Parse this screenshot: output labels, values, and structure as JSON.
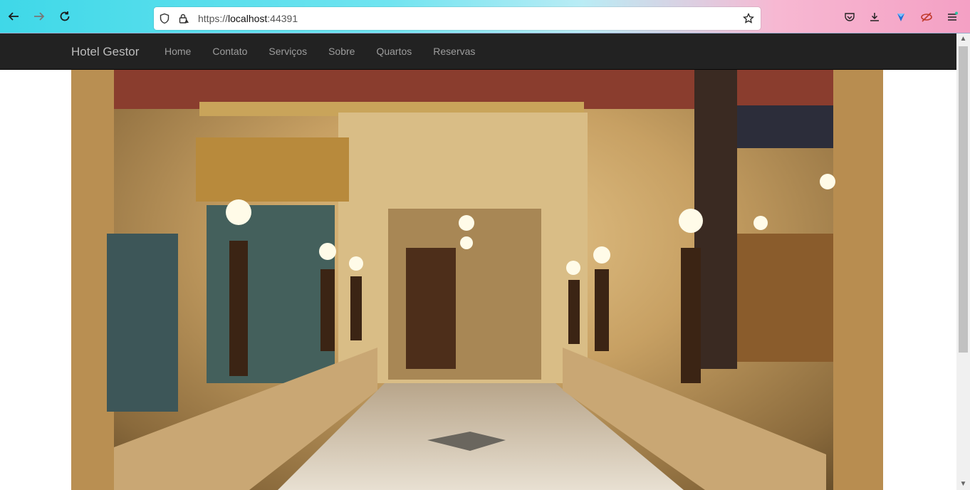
{
  "browser": {
    "url_prefix": "https://",
    "url_host": "localhost",
    "url_port": ":44391"
  },
  "site": {
    "brand": "Hotel Gestor",
    "nav": [
      {
        "label": "Home"
      },
      {
        "label": "Contato"
      },
      {
        "label": "Serviços"
      },
      {
        "label": "Sobre"
      },
      {
        "label": "Quartos"
      },
      {
        "label": "Reservas"
      }
    ]
  },
  "icons": {
    "back": "arrow-left-icon",
    "forward": "arrow-right-icon",
    "reload": "reload-icon",
    "shield": "shield-icon",
    "lock": "lock-warning-icon",
    "star": "bookmark-star-icon",
    "pocket": "pocket-icon",
    "download": "download-icon",
    "extension": "extension-icon",
    "privacy": "eye-slash-icon",
    "menu": "hamburger-menu-icon"
  },
  "colors": {
    "navbar_bg": "#222222",
    "nav_link": "#9d9d9d",
    "brand": "#bcbcbc"
  }
}
